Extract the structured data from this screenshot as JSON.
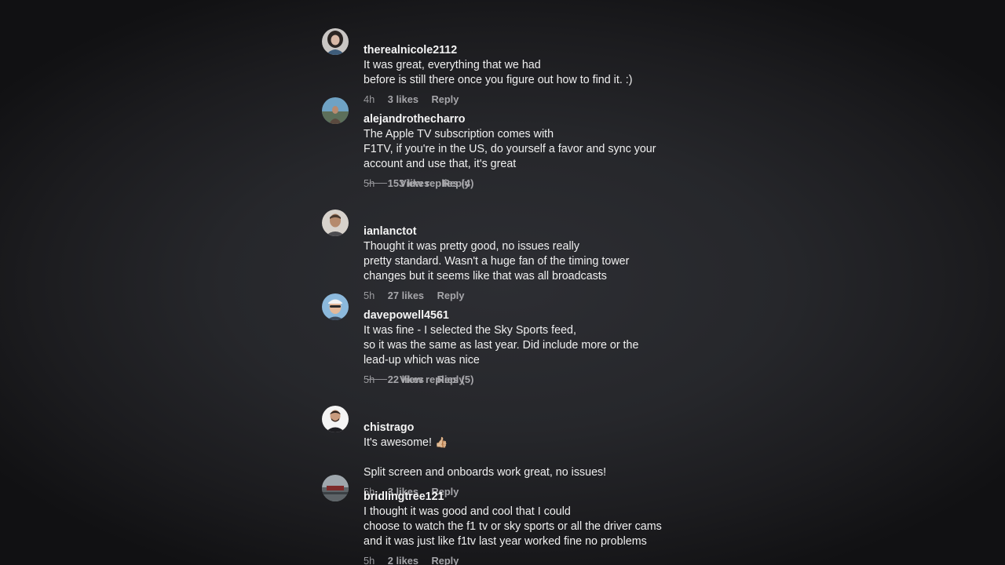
{
  "comments": [
    {
      "username": "therealnicole2112",
      "text": "It was great, everything that we had\nbefore is still there once you figure out how to find it. :)",
      "time": "4h",
      "likes": "3 likes",
      "reply": "Reply"
    },
    {
      "username": "alejandrothecharro",
      "text": "The Apple TV subscription comes with\nF1TV, if you're in the US, do yourself a favor and sync your\naccount and use that, it's great",
      "time": "5h",
      "likes": "153 likes",
      "reply": "Reply",
      "view_replies": "View replies (4)"
    },
    {
      "username": "ianlanctot",
      "text": "Thought it was pretty good, no issues really\npretty standard. Wasn't a huge fan of the timing tower\nchanges but it seems like that was all broadcasts",
      "time": "5h",
      "likes": "27 likes",
      "reply": "Reply"
    },
    {
      "username": "davepowell4561",
      "text": "It was fine - I selected the Sky Sports feed,\nso it was the same as last year. Did include more or the\nlead-up which was nice",
      "time": "5h",
      "likes": "22 likes",
      "reply": "Reply",
      "view_replies": "View replies (5)"
    },
    {
      "username": "chistrago",
      "text": "It's awesome! ",
      "emoji": "👍🏼",
      "text2": "Split screen and onboards work great, no issues!",
      "time": "5h",
      "likes": "3 likes",
      "reply": "Reply"
    },
    {
      "username": "bridlingtree121",
      "text": "I thought it was good and cool that I could\nchoose to watch the f1 tv or sky sports or all the driver cams\nand it was just like f1tv last year worked fine no problems",
      "time": "5h",
      "likes": "2 likes",
      "reply": "Reply"
    }
  ]
}
